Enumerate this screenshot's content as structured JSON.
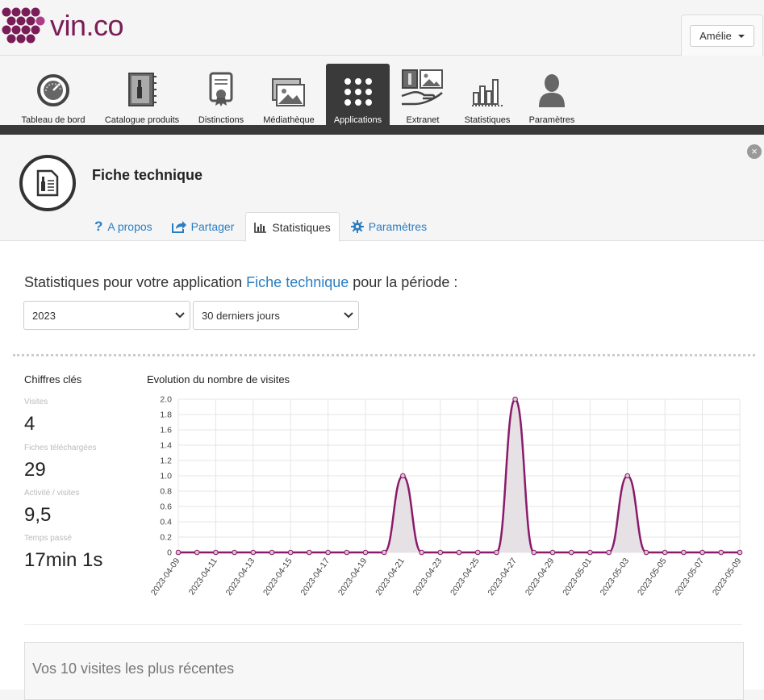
{
  "brand": {
    "name_main": "vin",
    "name_suffix": ".co",
    "color": "#7a1d57"
  },
  "user": {
    "name": "Amélie"
  },
  "nav": [
    {
      "label": "Tableau de bord",
      "icon": "dashboard-gauge-icon"
    },
    {
      "label": "Catalogue produits",
      "icon": "catalog-book-icon"
    },
    {
      "label": "Distinctions",
      "icon": "award-certificate-icon"
    },
    {
      "label": "Médiathèque",
      "icon": "media-images-icon"
    },
    {
      "label": "Applications",
      "icon": "apps-grid-icon",
      "active": true
    },
    {
      "label": "Extranet",
      "icon": "extranet-hand-icon"
    },
    {
      "label": "Statistiques",
      "icon": "bar-chart-icon"
    },
    {
      "label": "Paramètres",
      "icon": "user-profile-icon"
    }
  ],
  "panel": {
    "title": "Fiche technique",
    "tabs": [
      {
        "label": "A propos",
        "icon": "question-icon"
      },
      {
        "label": "Partager",
        "icon": "share-icon"
      },
      {
        "label": "Statistiques",
        "icon": "bar-chart-icon",
        "active": true
      },
      {
        "label": "Paramètres",
        "icon": "gear-icon"
      }
    ]
  },
  "stats": {
    "heading_prefix": "Statistiques pour votre application ",
    "heading_app": "Fiche technique",
    "heading_suffix": " pour la période :",
    "year_select": "2023",
    "period_select": "30 derniers jours"
  },
  "kpis": {
    "title": "Chiffres clés",
    "items": [
      {
        "label": "Visites",
        "value": "4"
      },
      {
        "label": "Fiches téléchargées",
        "value": "29"
      },
      {
        "label": "Activité / visites",
        "value": "9,5"
      },
      {
        "label": "Temps passé",
        "value": "17min 1s"
      }
    ]
  },
  "chart_data": {
    "type": "area",
    "title": "Evolution du nombre de visites",
    "x": [
      "2023-04-09",
      "2023-04-10",
      "2023-04-11",
      "2023-04-12",
      "2023-04-13",
      "2023-04-14",
      "2023-04-15",
      "2023-04-16",
      "2023-04-17",
      "2023-04-18",
      "2023-04-19",
      "2023-04-20",
      "2023-04-21",
      "2023-04-22",
      "2023-04-23",
      "2023-04-24",
      "2023-04-25",
      "2023-04-26",
      "2023-04-27",
      "2023-04-28",
      "2023-04-29",
      "2023-04-30",
      "2023-05-01",
      "2023-05-02",
      "2023-05-03",
      "2023-05-04",
      "2023-05-05",
      "2023-05-06",
      "2023-05-07",
      "2023-05-08",
      "2023-05-09"
    ],
    "x_tick_labels": [
      "2023-04-09",
      "2023-04-11",
      "2023-04-13",
      "2023-04-15",
      "2023-04-17",
      "2023-04-19",
      "2023-04-21",
      "2023-04-23",
      "2023-04-25",
      "2023-04-27",
      "2023-04-29",
      "2023-05-01",
      "2023-05-03",
      "2023-05-05",
      "2023-05-07",
      "2023-05-09"
    ],
    "values": [
      0,
      0,
      0,
      0,
      0,
      0,
      0,
      0,
      0,
      0,
      0,
      0,
      1,
      0,
      0,
      0,
      0,
      0,
      2,
      0,
      0,
      0,
      0,
      0,
      1,
      0,
      0,
      0,
      0,
      0,
      0
    ],
    "ylim": [
      0,
      2.0
    ],
    "y_ticks": [
      "0",
      "0.2",
      "0.4",
      "0.6",
      "0.8",
      "1.0",
      "1.2",
      "1.4",
      "1.6",
      "1.8",
      "2.0"
    ],
    "grid": true,
    "line_color": "#8b1a6b",
    "fill_color": "#e6e1e4"
  },
  "recent": {
    "title": "Vos 10 visites les plus récentes"
  }
}
